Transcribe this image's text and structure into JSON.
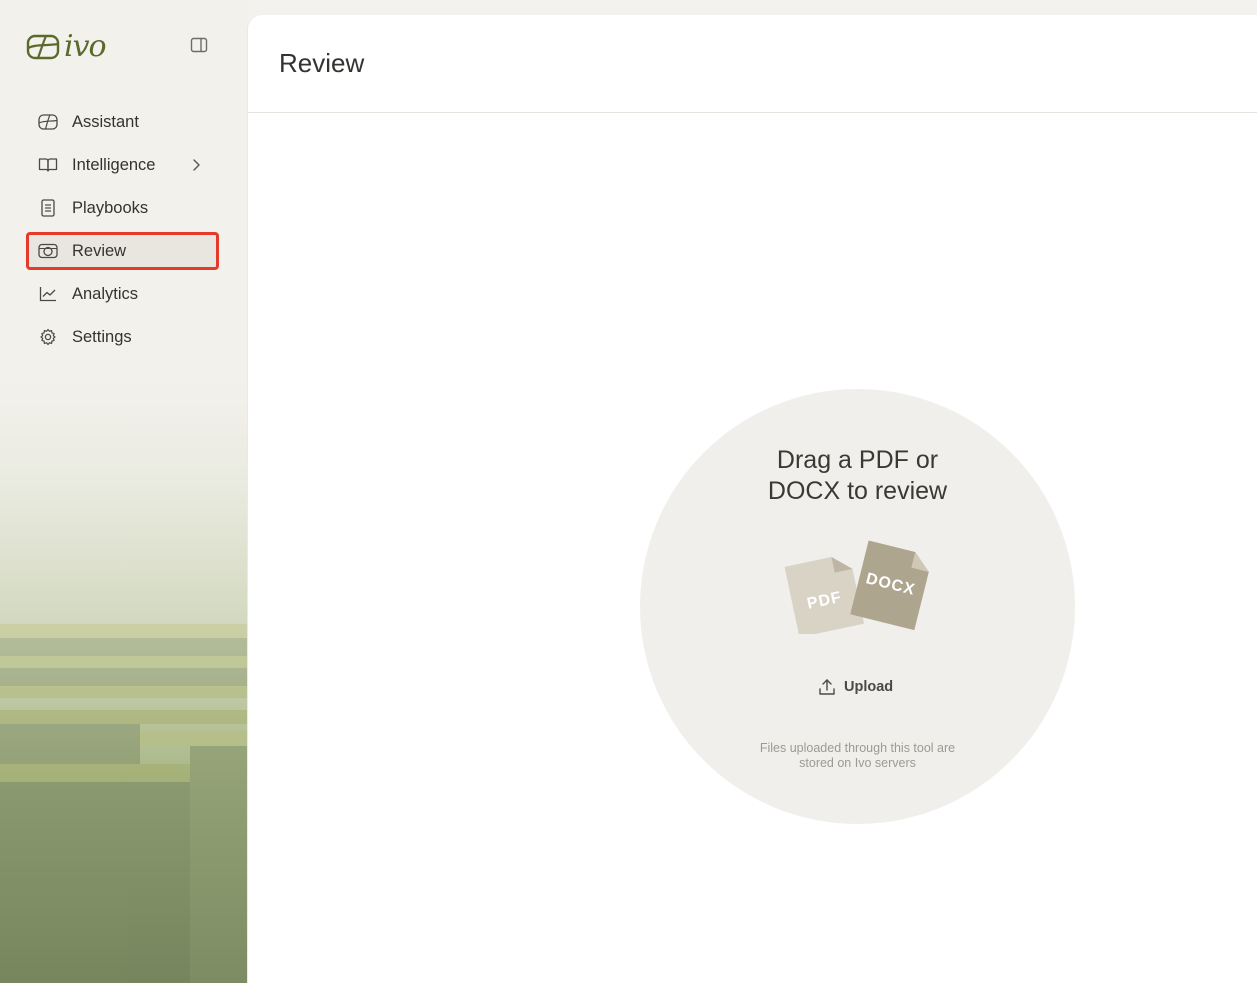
{
  "app": {
    "logo_text": "ivo"
  },
  "sidebar": {
    "items": [
      {
        "label": "Assistant",
        "icon": "assistant-icon"
      },
      {
        "label": "Intelligence",
        "icon": "book-icon",
        "has_submenu": true
      },
      {
        "label": "Playbooks",
        "icon": "document-icon"
      },
      {
        "label": "Review",
        "icon": "review-icon",
        "active": true
      },
      {
        "label": "Analytics",
        "icon": "chart-icon"
      },
      {
        "label": "Settings",
        "icon": "gear-icon"
      }
    ]
  },
  "main": {
    "title": "Review",
    "drop_zone": {
      "title_line1": "Drag a PDF or",
      "title_line2": "DOCX to review",
      "file_badges": [
        "PDF",
        "DOCX"
      ],
      "upload_label": "Upload",
      "note_line1": "Files uploaded through this tool are",
      "note_line2": "stored on Ivo servers"
    }
  },
  "colors": {
    "brand": "#5a6a2c",
    "active_outline": "#e53a2b",
    "active_bg": "#e9e6df",
    "drop_bg": "#f1efeb",
    "pdf_file": "#d8d3c5",
    "docx_file": "#aea58f"
  }
}
